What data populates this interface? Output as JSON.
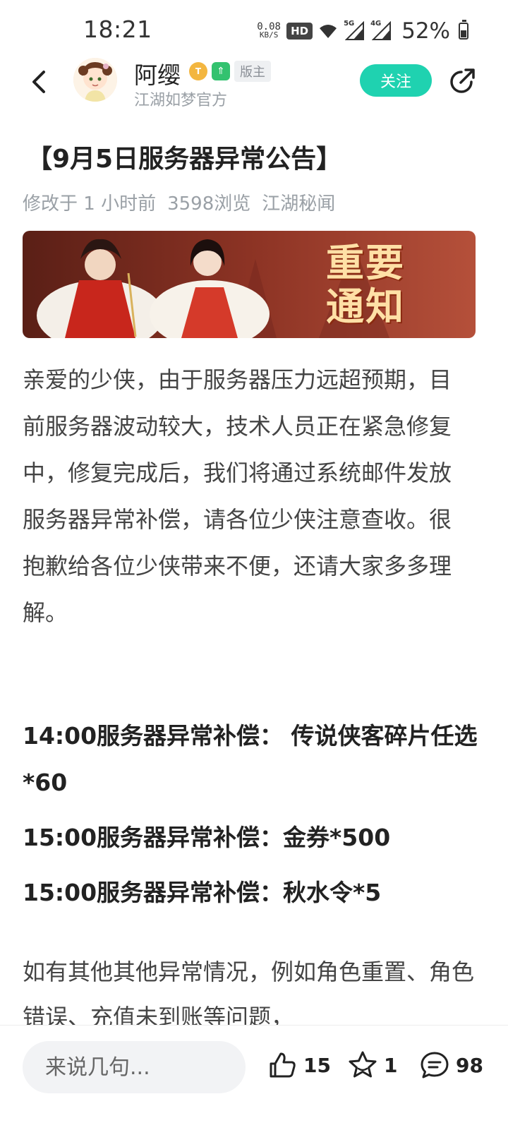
{
  "status_bar": {
    "time": "18:21",
    "net_speed_value": "0.08",
    "net_speed_unit": "KB/S",
    "hd_label": "HD",
    "signal_1_label": "5G",
    "signal_2_label": "4G",
    "battery_percent": "52%",
    "battery_level": 0.52
  },
  "header": {
    "author_name": "阿缨",
    "author_subtitle": "江湖如梦官方",
    "moderator_badge": "版主",
    "level_badge": "T",
    "follow_label": "关注"
  },
  "post": {
    "title": "【9月5日服务器异常公告】",
    "modified": "修改于 1 小时前",
    "views": "3598浏览",
    "section": "江湖秘闻",
    "banner_text_line1": "重要",
    "banner_text_line2": "通知",
    "body": "亲爱的少侠，由于服务器压力远超预期，目前服务器波动较大，技术人员正在紧急修复中，修复完成后，我们将通过系统邮件发放服务器异常补偿，请各位少侠注意查收。很抱歉给各位少侠带来不便，还请大家多多理解。",
    "compensations": [
      "14:00服务器异常补偿： 传说侠客碎片任选*60",
      "15:00服务器异常补偿：金券*500",
      "15:00服务器异常补偿：秋水令*5"
    ],
    "body_2": "如有其他其他异常情况，例如角色重置、角色错误、充值未到账等问题，"
  },
  "bottom_bar": {
    "comment_placeholder": "来说几句...",
    "like_count": "15",
    "favorite_count": "1",
    "comment_count": "98"
  },
  "colors": {
    "accent": "#1fd2b0",
    "muted_text": "#9aa0a6",
    "body_text": "#444444"
  }
}
